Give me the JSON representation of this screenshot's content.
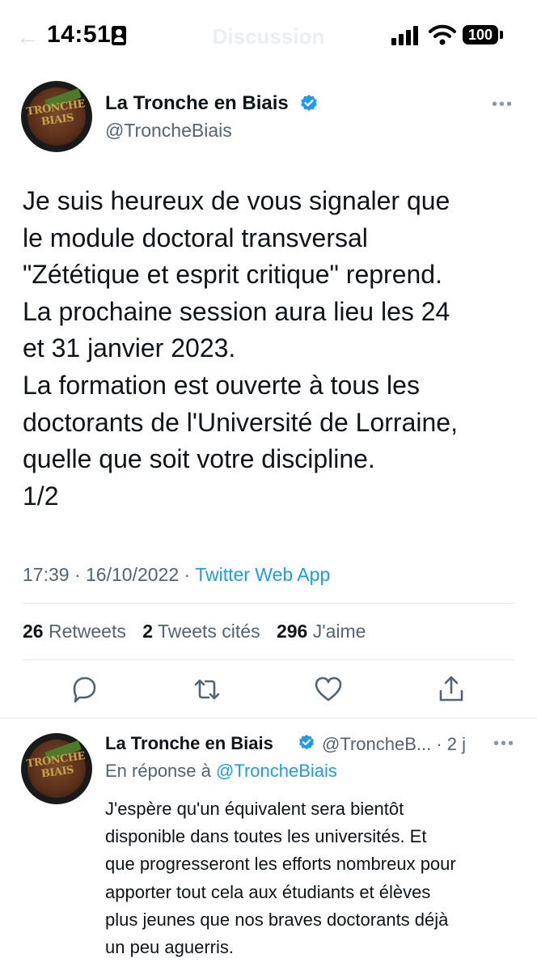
{
  "status_bar": {
    "time": "14:51",
    "title": "Discussion",
    "battery": "100"
  },
  "tweet": {
    "author_name": "La Tronche en Biais",
    "handle": "@TroncheBiais",
    "avatar_text": "TRONCHE BIAIS",
    "text": "Je suis heureux de vous signaler que\nle module doctoral transversal\n\"Zététique et esprit critique\" reprend.\nLa prochaine session aura lieu les 24\net 31 janvier 2023.\nLa formation est ouverte à tous les\ndoctorants de l'Université de Lorraine,\nquelle que soit votre discipline.\n1/2",
    "time": "17:39",
    "date": "16/10/2022",
    "separator": "·",
    "source": "Twitter Web App",
    "retweets_count": "26",
    "retweets_label": "Retweets",
    "quotes_count": "2",
    "quotes_label": "Tweets cités",
    "likes_count": "296",
    "likes_label": "J'aime",
    "actions": [
      "reply-icon",
      "retweet-icon",
      "like-icon",
      "share-icon"
    ]
  },
  "reply": {
    "author_name": "La Tronche en Biais",
    "handle": "@TroncheB...",
    "age": "· 2 j",
    "in_reply_prefix": "En réponse à",
    "in_reply_mention": "@TroncheBiais",
    "text": "J'espère qu'un équivalent sera bientôt\ndisponible dans toutes les universités. Et\nque progresseront les efforts nombreux pour\napporter tout cela aux étudiants et élèves\nplus jeunes que nos braves doctorants déjà\nun peu aguerris."
  },
  "colors": {
    "accent": "#1d9bf0",
    "secondary_text": "#536471",
    "primary_text": "#0f1419",
    "divider": "#e6e9ec"
  }
}
